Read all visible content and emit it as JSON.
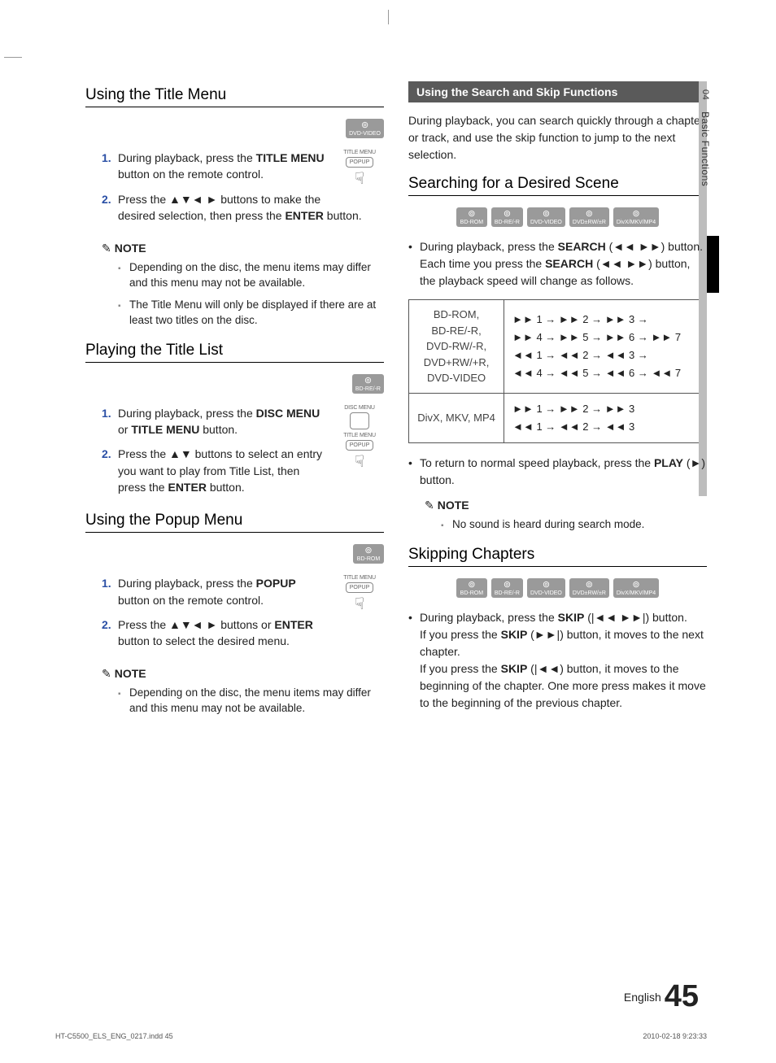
{
  "sideTab": {
    "num": "04",
    "label": "Basic Functions"
  },
  "left": {
    "titleMenu": {
      "heading": "Using the Title Menu",
      "badges": [
        "DVD-VIDEO"
      ],
      "diagram": {
        "l1": "TITLE MENU",
        "l2": "POPUP"
      },
      "steps": [
        "During playback, press the <b>TITLE MENU</b> button on the remote control.",
        "Press the ▲▼◄ ► buttons to make the desired selection, then press the <b>ENTER</b> button."
      ],
      "noteLabel": "NOTE",
      "notes": [
        "Depending on the disc, the menu items may differ and this menu may not be available.",
        "The Title Menu will only be displayed if there are at least two titles on the disc."
      ]
    },
    "titleList": {
      "heading": "Playing the Title List",
      "badges": [
        "BD-RE/-R"
      ],
      "diagram": {
        "l0": "DISC MENU",
        "l1": "TITLE MENU",
        "l2": "POPUP"
      },
      "steps": [
        "During playback, press the <b>DISC MENU</b> or <b>TITLE MENU</b> button.",
        "Press the ▲▼ buttons to select an entry you want to play from Title List, then press the <b>ENTER</b> button."
      ]
    },
    "popupMenu": {
      "heading": "Using the Popup Menu",
      "badges": [
        "BD-ROM"
      ],
      "diagram": {
        "l1": "TITLE MENU",
        "l2": "POPUP"
      },
      "steps": [
        "During playback, press the <b>POPUP</b> button on the remote control.",
        "Press the ▲▼◄ ► buttons or <b>ENTER</b> button to select the desired menu."
      ],
      "noteLabel": "NOTE",
      "notes": [
        "Depending on the disc, the menu items may differ and this menu may not be available."
      ]
    }
  },
  "right": {
    "searchSkip": {
      "heading": "Using the Search and Skip Functions",
      "intro": "During playback, you can search quickly through a chapter or track, and use the skip function to jump to the next selection."
    },
    "searching": {
      "heading": "Searching for a Desired Scene",
      "badges": [
        "BD-ROM",
        "BD-RE/-R",
        "DVD-VIDEO",
        "DVD±RW/±R",
        "DivX/MKV/MP4"
      ],
      "bullet1_a": "During playback, press the ",
      "bullet1_b_strong": "SEARCH",
      "bullet1_c": " (◄◄ ►►) button.",
      "bullet1_line2_a": "Each time you press the ",
      "bullet1_line2_b_strong": "SEARCH",
      "bullet1_line2_c": " (◄◄ ►►) button, the playback speed will change as follows.",
      "table": {
        "row1_left": "BD-ROM,\nBD-RE/-R,\nDVD-RW/-R,\nDVD+RW/+R,\nDVD-VIDEO",
        "row1_right": "►► 1 → ►► 2 → ►► 3 →\n►► 4 → ►► 5 → ►► 6 → ►► 7\n◄◄ 1 → ◄◄ 2 → ◄◄ 3 →\n◄◄ 4 → ◄◄ 5 → ◄◄ 6 → ◄◄ 7",
        "row2_left": "DivX, MKV, MP4",
        "row2_right": "►► 1 → ►► 2 → ►► 3\n◄◄ 1 → ◄◄ 2 → ◄◄ 3"
      },
      "bullet2_a": "To return to normal speed playback, press the ",
      "bullet2_b_strong": "PLAY",
      "bullet2_c": " (►) button.",
      "noteLabel": "NOTE",
      "notes": [
        "No sound is heard during search mode."
      ]
    },
    "skipping": {
      "heading": "Skipping Chapters",
      "badges": [
        "BD-ROM",
        "BD-RE/-R",
        "DVD-VIDEO",
        "DVD±RW/±R",
        "DivX/MKV/MP4"
      ],
      "bullet_a": "During playback, press the ",
      "bullet_b_strong": "SKIP",
      "bullet_c": " (|◄◄ ►►|) button.",
      "line2_a": "If you press the ",
      "line2_b_strong": "SKIP",
      "line2_c": " (►►|) button, it moves to the next chapter.",
      "line3_a": "If you press the ",
      "line3_b_strong": "SKIP",
      "line3_c": " (|◄◄) button, it moves to the beginning of the chapter. One more press makes it move to the beginning of the previous chapter."
    }
  },
  "footer": {
    "langLabel": "English",
    "pageNum": "45",
    "leftMeta": "HT-C5500_ELS_ENG_0217.indd   45",
    "rightMeta": "2010-02-18    9:23:33"
  }
}
